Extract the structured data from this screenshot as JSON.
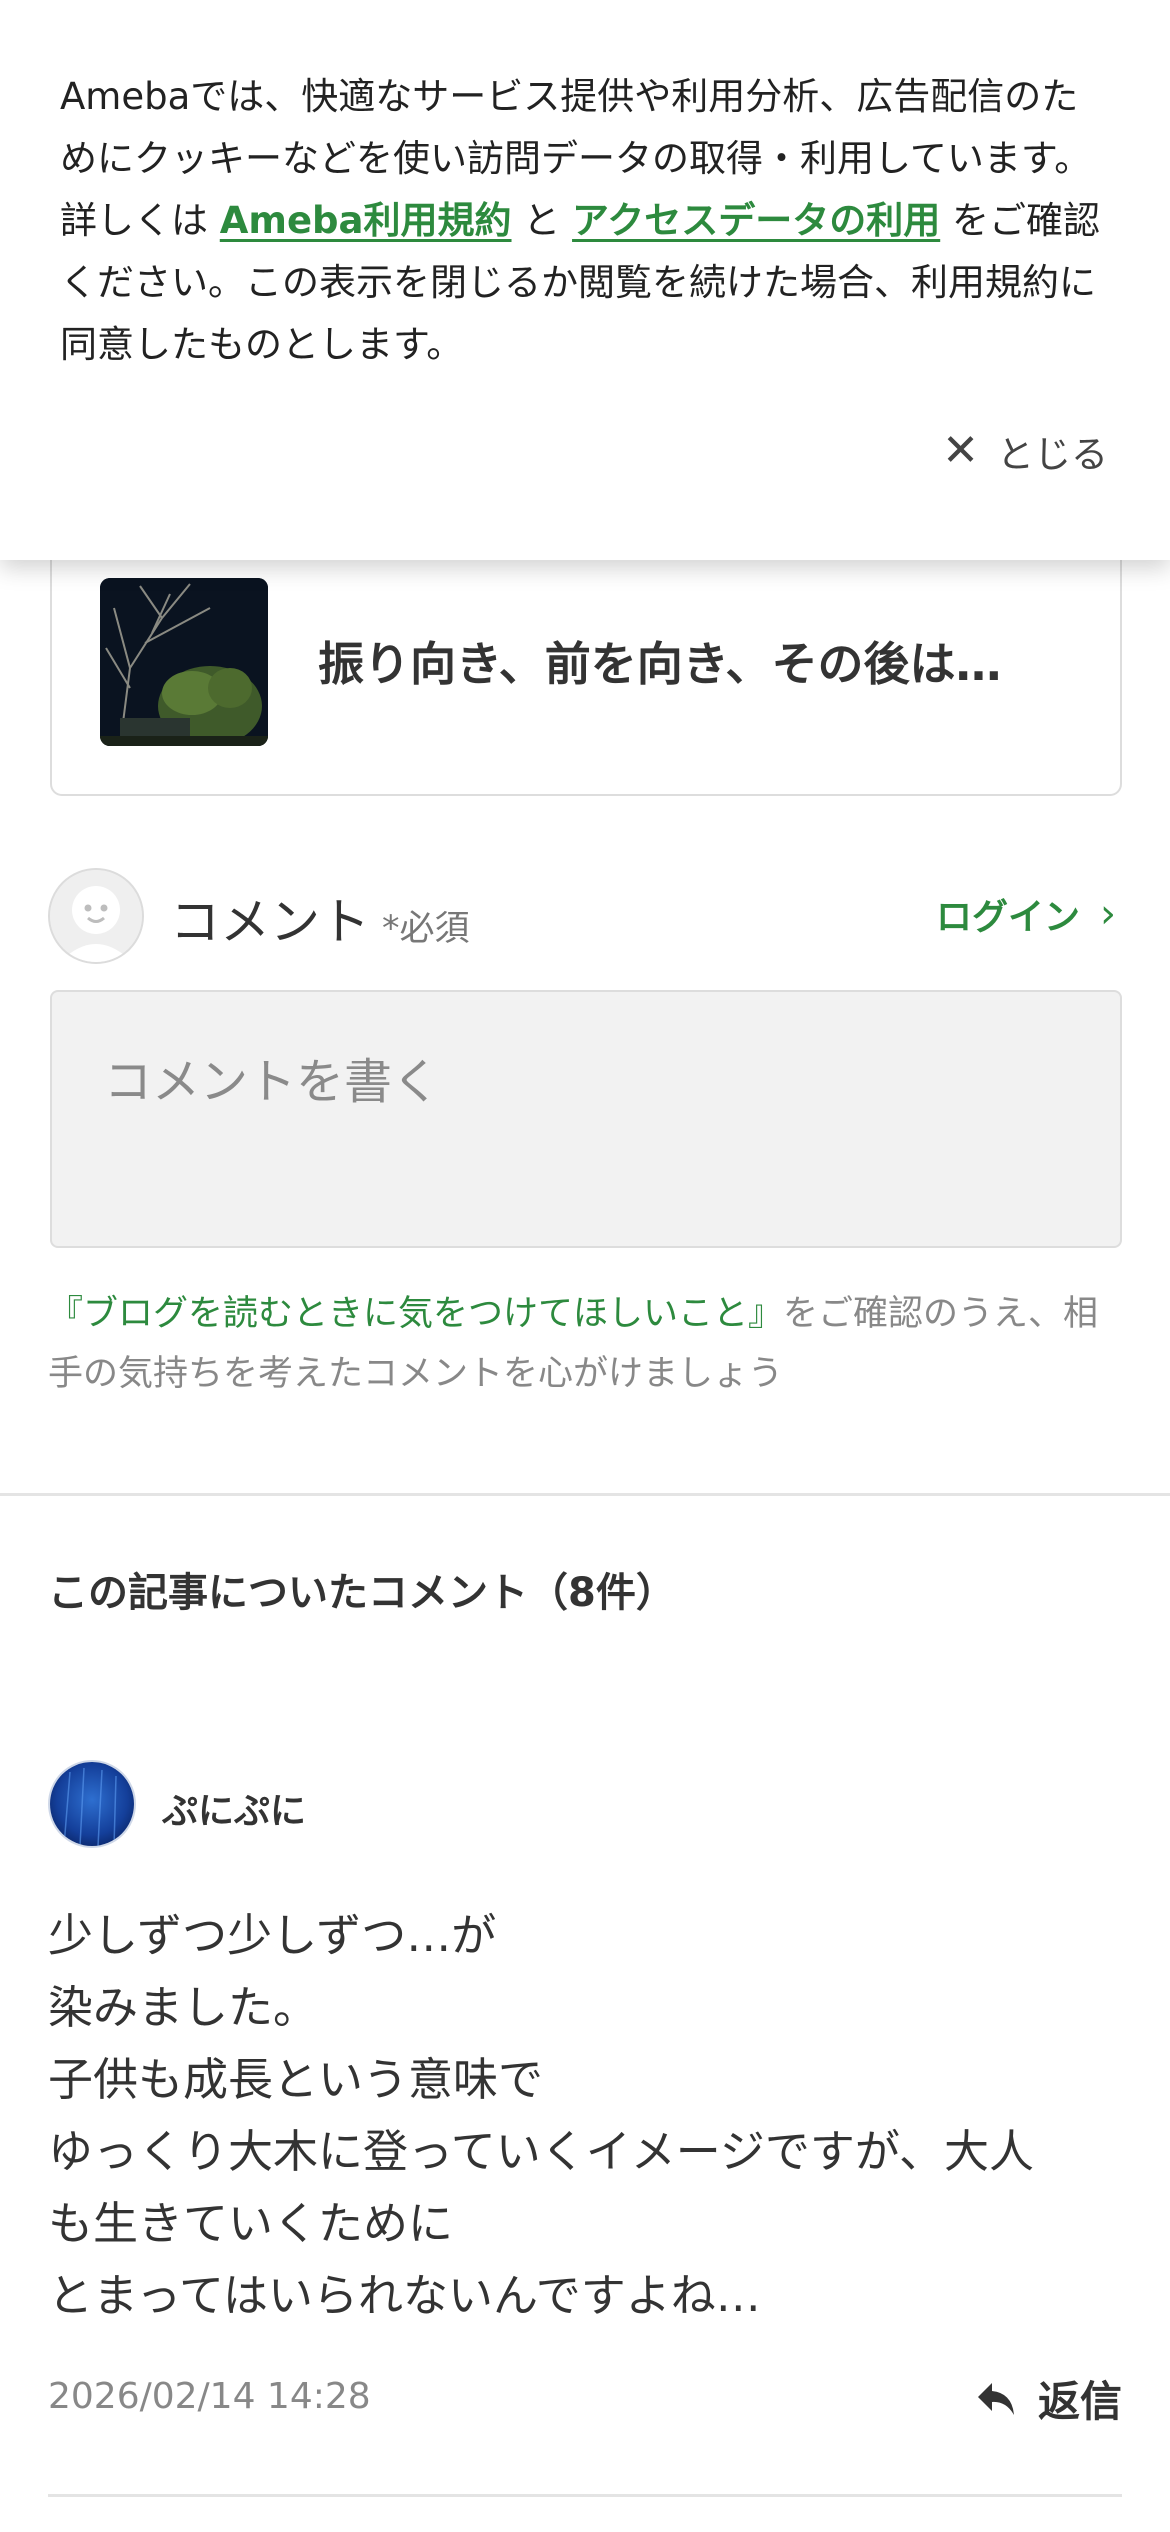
{
  "cookie_banner": {
    "text_part1": "Amebaでは、快適なサービス提供や利用分析、広告配信のためにクッキーなどを使い訪問データの取得・利用しています。詳しくは ",
    "link_terms": "Ameba利用規約",
    "text_and": " と ",
    "link_access_data": "アクセスデータの利用",
    "text_part2": " をご確認ください。この表示を閉じるか閲覧を続けた場合、利用規約に同意したものとします。",
    "close_label": "とじる",
    "close_icon": "close-icon",
    "link_color": "#2d8a3e"
  },
  "related_article": {
    "title": "振り向き、前を向き、その後は…"
  },
  "comment_form": {
    "label": "コメント",
    "required": "*必須",
    "login": "ログイン",
    "placeholder": "コメントを書く",
    "notice_link": "『ブログを読むときに気をつけてほしいこと』",
    "notice_text": "をご確認のうえ、相手の気持ちを考えたコメントを心がけましょう"
  },
  "comments_section": {
    "title": "この記事についたコメント（8件）",
    "items": [
      {
        "user": "ぷにぷに",
        "lines": [
          "少しずつ少しずつ…が",
          "染みました。",
          "子供も成長という意味で",
          "ゆっくり大木に登っていくイメージですが、大人",
          "も生きていくために",
          "とまってはいられないんですよね…"
        ],
        "date": "2026/02/14 14:28",
        "reply_label": "返信"
      }
    ]
  }
}
